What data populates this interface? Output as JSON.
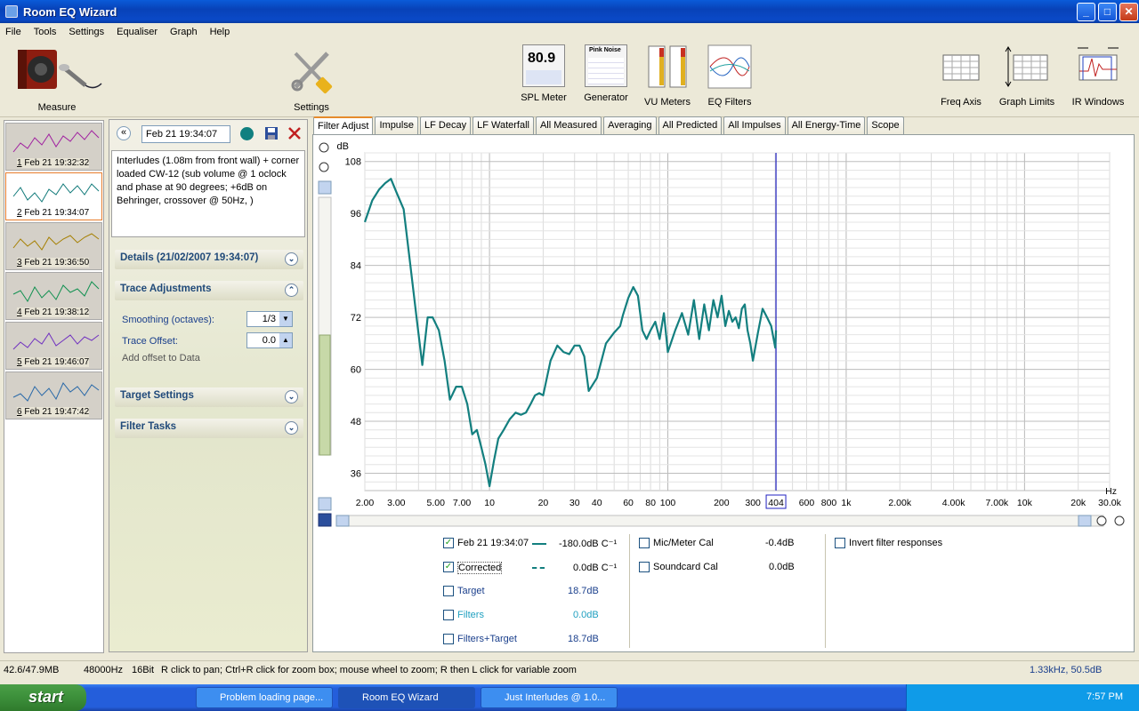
{
  "window": {
    "title": "Room EQ Wizard"
  },
  "menu": [
    "File",
    "Tools",
    "Settings",
    "Equaliser",
    "Graph",
    "Help"
  ],
  "toolbar": {
    "measure": "Measure",
    "settings": "Settings",
    "spl_meter": "SPL Meter",
    "spl_value": "80.9",
    "generator": "Generator",
    "generator_mode": "Pink Noise",
    "vu_meters": "VU Meters",
    "eq_filters": "EQ Filters",
    "freq_axis": "Freq Axis",
    "graph_limits": "Graph Limits",
    "ir_windows": "IR Windows"
  },
  "traces": [
    {
      "num": "1",
      "label": " Feb 21 19:32:32",
      "color": "#a020a0"
    },
    {
      "num": "2",
      "label": " Feb 21 19:34:07",
      "color": "#117a7a"
    },
    {
      "num": "3",
      "label": " Feb 21 19:36:50",
      "color": "#a57f00"
    },
    {
      "num": "4",
      "label": " Feb 21 19:38:12",
      "color": "#109050"
    },
    {
      "num": "5",
      "label": " Feb 21 19:46:07",
      "color": "#7030c0"
    },
    {
      "num": "6",
      "label": " Feb 21 19:47:42",
      "color": "#2868a8"
    }
  ],
  "panel": {
    "measurement_name": "Feb 21 19:34:07",
    "notes": "Interludes (1.08m from front wall) + corner loaded CW-12 (sub volume @ 1 oclock and phase at 90 degrees; +6dB on Behringer, crossover @ 50Hz, )",
    "details": "Details  (21/02/2007 19:34:07)",
    "trace_adjustments": "Trace Adjustments",
    "smoothing_label": "Smoothing (octaves):",
    "smoothing_value": "1/3",
    "trace_offset_label": "Trace Offset:",
    "trace_offset_value": "0.0",
    "add_offset": "Add offset to Data",
    "target_settings": "Target Settings",
    "filter_tasks": "Filter Tasks"
  },
  "tabs": [
    "Filter Adjust",
    "Impulse",
    "LF Decay",
    "LF Waterfall",
    "All Measured",
    "Averaging",
    "All Predicted",
    "All Impulses",
    "All Energy-Time",
    "Scope"
  ],
  "graph": {
    "y_unit": "dB",
    "x_unit": "Hz",
    "cursor_freq": "404",
    "y_ticks": [
      {
        "v": 108,
        "t": "108"
      },
      {
        "v": 96,
        "t": "96"
      },
      {
        "v": 84,
        "t": "84"
      },
      {
        "v": 72,
        "t": "72"
      },
      {
        "v": 60,
        "t": "60"
      },
      {
        "v": 48,
        "t": "48"
      },
      {
        "v": 36,
        "t": "36"
      }
    ],
    "x_ticks": [
      {
        "f": 2,
        "t": "2.00"
      },
      {
        "f": 3,
        "t": "3.00"
      },
      {
        "f": 5,
        "t": "5.00"
      },
      {
        "f": 7,
        "t": "7.00"
      },
      {
        "f": 10,
        "t": "10"
      },
      {
        "f": 20,
        "t": "20"
      },
      {
        "f": 30,
        "t": "30"
      },
      {
        "f": 40,
        "t": "40"
      },
      {
        "f": 60,
        "t": "60"
      },
      {
        "f": 80,
        "t": "80"
      },
      {
        "f": 100,
        "t": "100"
      },
      {
        "f": 200,
        "t": "200"
      },
      {
        "f": 300,
        "t": "300"
      },
      {
        "f": 600,
        "t": "600"
      },
      {
        "f": 800,
        "t": "800"
      },
      {
        "f": 1000,
        "t": "1k"
      },
      {
        "f": 2000,
        "t": "2.00k"
      },
      {
        "f": 4000,
        "t": "4.00k"
      },
      {
        "f": 7000,
        "t": "7.00k"
      },
      {
        "f": 10000,
        "t": "10k"
      },
      {
        "f": 20000,
        "t": "20k"
      },
      {
        "f": 30000,
        "t": "30.0k"
      }
    ]
  },
  "chart_data": {
    "type": "line",
    "xlabel": "Hz",
    "ylabel": "dB",
    "x_scale": "log",
    "xlim": [
      2,
      30000
    ],
    "ylim": [
      32,
      110
    ],
    "grid": true,
    "series": [
      {
        "name": "Feb 21 19:34:07",
        "color": "#137f7f",
        "x": [
          2,
          2.2,
          2.4,
          2.6,
          2.8,
          3.0,
          3.3,
          3.6,
          3.9,
          4.2,
          4.5,
          4.8,
          5.2,
          5.6,
          6.0,
          6.5,
          7.0,
          7.5,
          8.0,
          8.5,
          9.0,
          9.5,
          10,
          10.6,
          11.2,
          12,
          13,
          14,
          15,
          16,
          17,
          18,
          19,
          20,
          22,
          24,
          26,
          28,
          30,
          32,
          34,
          36,
          40,
          45,
          50,
          54,
          56,
          60,
          64,
          68,
          72,
          76,
          80,
          85,
          90,
          95,
          100,
          110,
          120,
          130,
          140,
          150,
          160,
          170,
          180,
          190,
          200,
          210,
          220,
          230,
          240,
          250,
          260,
          270,
          280,
          290,
          300,
          320,
          340,
          360,
          380,
          400,
          404
        ],
        "y": [
          94,
          99,
          101.5,
          103,
          104,
          101,
          97,
          84,
          72,
          61,
          72,
          72,
          69,
          62,
          53,
          56,
          56,
          52,
          45,
          46,
          42,
          38,
          33,
          39,
          44,
          46,
          48.5,
          50,
          49.5,
          50,
          52,
          54,
          54.5,
          54,
          62,
          65.5,
          64,
          63.5,
          65.5,
          65.5,
          63,
          55,
          58,
          66,
          68.5,
          70,
          72.5,
          76.5,
          79,
          77,
          69,
          67,
          69,
          71,
          67,
          73,
          64,
          69,
          73,
          68,
          76,
          67,
          75,
          69,
          76,
          72,
          77,
          70,
          73.5,
          71,
          72,
          69.5,
          74,
          75,
          69,
          66,
          62,
          68.5,
          74,
          72,
          70,
          65,
          69
        ]
      }
    ]
  },
  "legend": {
    "main": {
      "label": "Feb 21 19:34:07",
      "value": "-180.0dB C⁻¹",
      "checked": "✓"
    },
    "corrected": {
      "label": "Corrected",
      "value": "0.0dB C⁻¹",
      "checked": "✓"
    },
    "target": {
      "label": "Target",
      "value": "18.7dB"
    },
    "filters": {
      "label": "Filters",
      "value": "0.0dB"
    },
    "filters_target": {
      "label": "Filters+Target",
      "value": "18.7dB"
    },
    "mic_cal": {
      "label": "Mic/Meter Cal",
      "value": "-0.4dB"
    },
    "soundcard_cal": {
      "label": "Soundcard Cal",
      "value": "0.0dB"
    },
    "invert": {
      "label": "Invert filter responses"
    }
  },
  "status": {
    "memory": "42.6/47.9MB",
    "rate": "48000Hz",
    "bits": "16Bit",
    "hint": "R click to pan; Ctrl+R click for zoom box; mouse wheel to zoom; R then L click for variable zoom",
    "cursor": "1.33kHz, 50.5dB"
  },
  "taskbar": {
    "start": "start",
    "tasks": [
      "Problem loading page...",
      "Room EQ Wizard",
      "Just Interludes @ 1.0..."
    ],
    "clock": "7:57 PM"
  }
}
